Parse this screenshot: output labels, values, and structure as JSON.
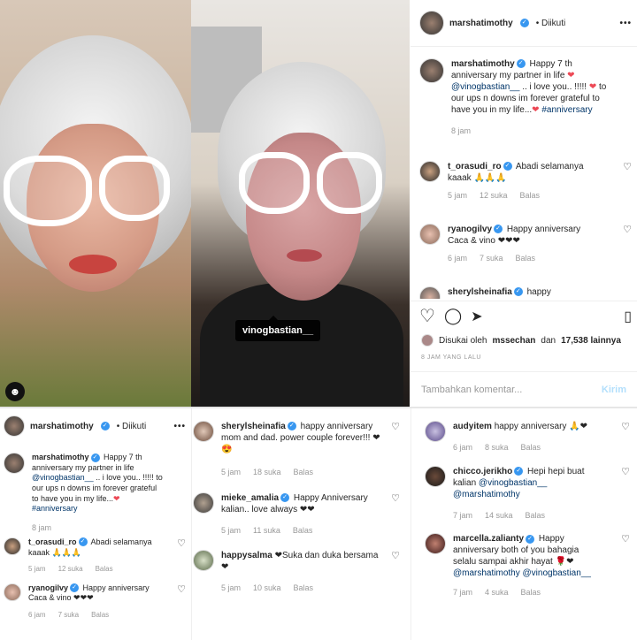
{
  "tag_label": "vinogbastian__",
  "post_header": {
    "username": "marshatimothy",
    "follow": "• Diikuti",
    "more": "•••"
  },
  "caption": {
    "username": "marshatimothy",
    "text1": "Happy 7 th anniversary my partner in life",
    "mention": "@vinogbastian__",
    "text2": ".. i love you.. !!!!! ",
    "text3": " to our ups n downs im forever grateful to have you in my life...",
    "hashtag": "#anniversary",
    "time": "8 jam"
  },
  "comments_right": [
    {
      "username": "t_orasudi_ro",
      "text": "Abadi selamanya kaaak 🙏🙏🙏",
      "time": "5 jam",
      "likes": "12 suka",
      "reply": "Balas"
    },
    {
      "username": "ryanogilvy",
      "text": "Happy anniversary Caca & vino ❤❤❤",
      "time": "6 jam",
      "likes": "7 suka",
      "reply": "Balas"
    },
    {
      "username": "sherylsheinafia",
      "text": "happy"
    }
  ],
  "actions": {
    "likes_prefix": "Disukai oleh",
    "likes_user": "mssechan",
    "likes_and": "dan",
    "likes_count": "17,538 lainnya",
    "ago": "8 JAM YANG LALU",
    "add_comment_placeholder": "Tambahkan komentar...",
    "post_button": "Kirim"
  },
  "bottom_left": {
    "username": "marshatimothy",
    "follow": "• Diikuti",
    "more": "•••",
    "caption_text1": "Happy 7 th anniversary my partner in life",
    "mention": "@vinogbastian__",
    "caption_text2": ".. i love you.. !!!!!",
    "caption_text3": "to our ups n downs im forever grateful to have you in my life...",
    "hashtag": "#anniversary",
    "time": "8 jam",
    "comments": [
      {
        "username": "t_orasudi_ro",
        "text": "Abadi selamanya kaaak 🙏🙏🙏",
        "time": "5 jam",
        "likes": "12 suka",
        "reply": "Balas"
      },
      {
        "username": "ryanogilvy",
        "text": "Happy anniversary Caca & vino ❤❤❤",
        "time": "6 jam",
        "likes": "7 suka",
        "reply": "Balas"
      }
    ]
  },
  "bottom_mid": [
    {
      "username": "sherylsheinafia",
      "text": "happy anniversary mom and dad. power couple forever!!! ❤ 😍",
      "time": "5 jam",
      "likes": "18 suka",
      "reply": "Balas"
    },
    {
      "username": "mieke_amalia",
      "text": "Happy Anniversary kalian.. love always ❤❤",
      "time": "5 jam",
      "likes": "11 suka",
      "reply": "Balas"
    },
    {
      "username": "happysalma",
      "text": "❤Suka dan duka bersama ❤",
      "time": "5 jam",
      "likes": "10 suka",
      "reply": "Balas"
    }
  ],
  "bottom_right": [
    {
      "username": "audyitem",
      "text": "happy anniversary 🙏❤",
      "time": "6 jam",
      "likes": "8 suka",
      "reply": "Balas"
    },
    {
      "username": "chicco.jerikho",
      "text": "Hepi hepi buat kalian",
      "mentions": "@vinogbastian__ @marshatimothy",
      "time": "7 jam",
      "likes": "14 suka",
      "reply": "Balas"
    },
    {
      "username": "marcella.zalianty",
      "text": "Happy anniversary both of you bahagia selalu sampai akhir hayat 🌹❤",
      "mentions": "@marshatimothy @vinogbastian__",
      "time": "7 jam",
      "likes": "4 suka",
      "reply": "Balas"
    }
  ],
  "colors": {
    "link": "#003569",
    "verified": "#3897f0",
    "heart": "#ed4956",
    "muted": "#999999"
  }
}
